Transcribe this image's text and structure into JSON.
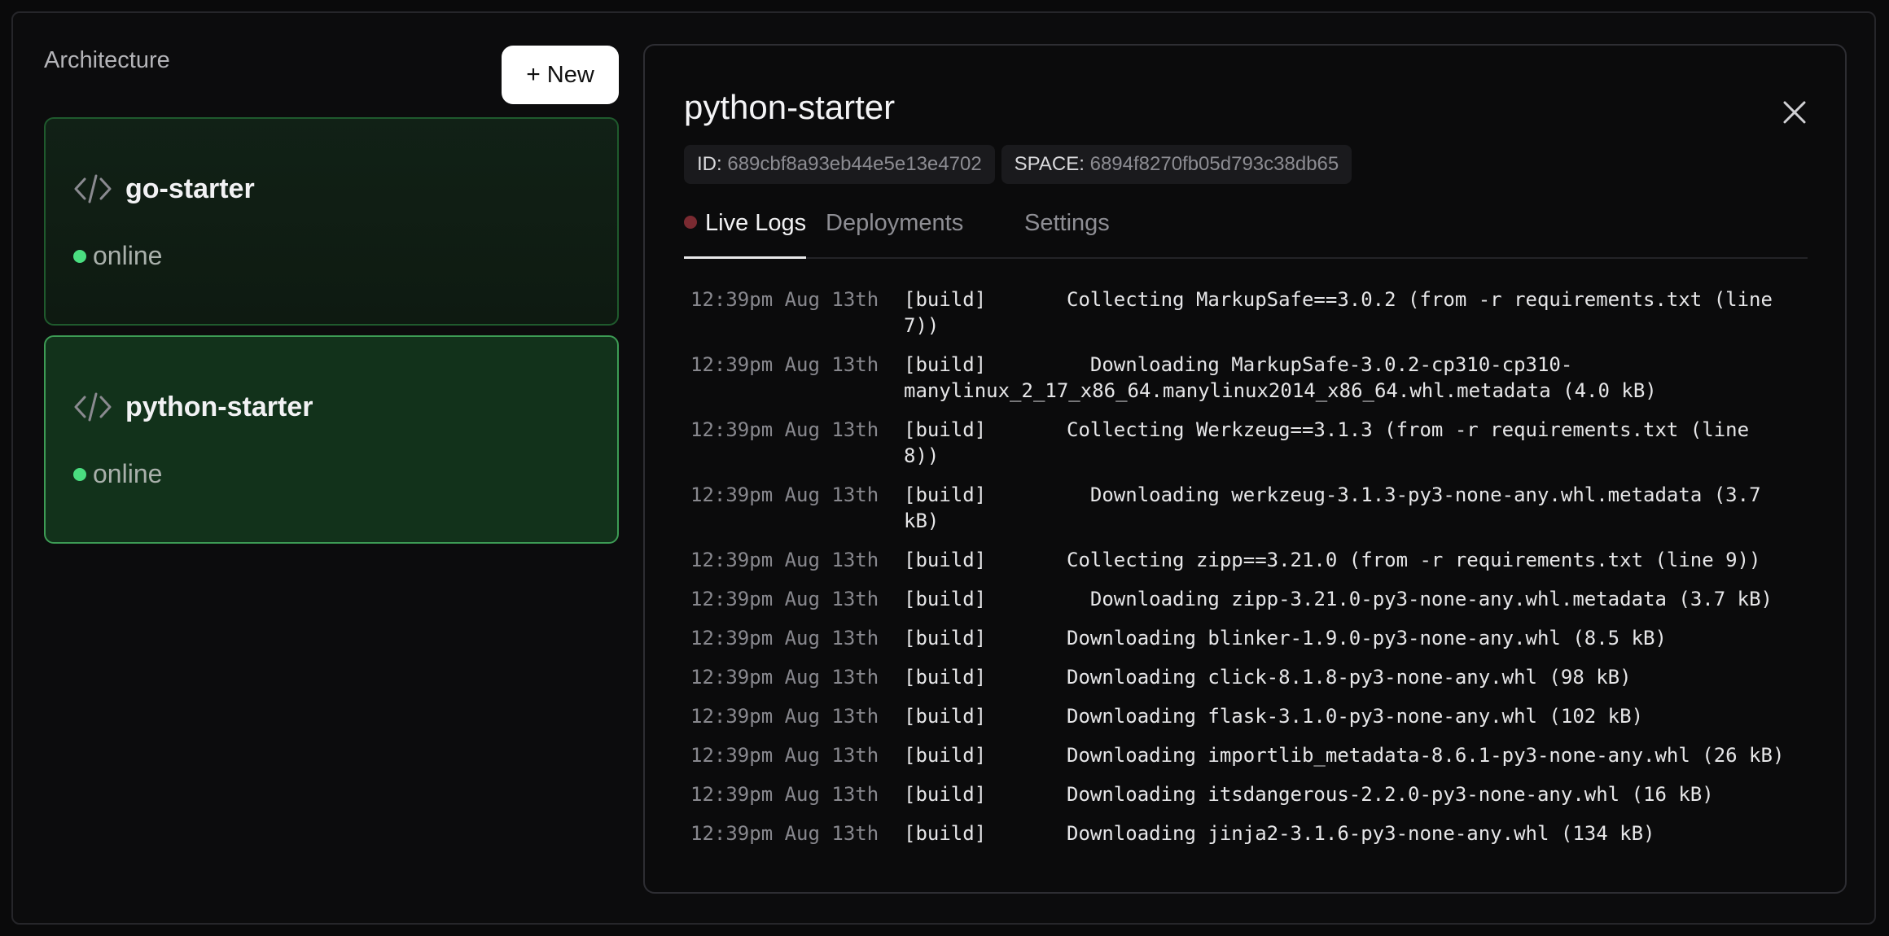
{
  "sidebar": {
    "title": "Architecture",
    "new_button": "New",
    "services": [
      {
        "name": "go-starter",
        "status": "online"
      },
      {
        "name": "python-starter",
        "status": "online"
      }
    ]
  },
  "panel": {
    "title": "python-starter",
    "id_label": "ID:",
    "id_value": "689cbf8a93eb44e5e13e4702",
    "space_label": "SPACE:",
    "space_value": "6894f8270fb05d793c38db65",
    "tabs": {
      "logs": "Live Logs",
      "deployments": "Deployments",
      "settings": "Settings"
    },
    "logs": [
      {
        "time": "12:39pm Aug 13th",
        "tag": "[build]",
        "line1": "Collecting MarkupSafe==3.0.2 (from -r requirements.txt (line",
        "line2": "7))"
      },
      {
        "time": "12:39pm Aug 13th",
        "tag": "[build]",
        "line1": "  Downloading MarkupSafe-3.0.2-cp310-cp310-",
        "line2": "manylinux_2_17_x86_64.manylinux2014_x86_64.whl.metadata (4.0 kB)"
      },
      {
        "time": "12:39pm Aug 13th",
        "tag": "[build]",
        "line1": "Collecting Werkzeug==3.1.3 (from -r requirements.txt (line",
        "line2": "8))"
      },
      {
        "time": "12:39pm Aug 13th",
        "tag": "[build]",
        "line1": "  Downloading werkzeug-3.1.3-py3-none-any.whl.metadata (3.7",
        "line2": "kB)"
      },
      {
        "time": "12:39pm Aug 13th",
        "tag": "[build]",
        "line1": "Collecting zipp==3.21.0 (from -r requirements.txt (line 9))"
      },
      {
        "time": "12:39pm Aug 13th",
        "tag": "[build]",
        "line1": "  Downloading zipp-3.21.0-py3-none-any.whl.metadata (3.7 kB)"
      },
      {
        "time": "12:39pm Aug 13th",
        "tag": "[build]",
        "line1": "Downloading blinker-1.9.0-py3-none-any.whl (8.5 kB)"
      },
      {
        "time": "12:39pm Aug 13th",
        "tag": "[build]",
        "line1": "Downloading click-8.1.8-py3-none-any.whl (98 kB)"
      },
      {
        "time": "12:39pm Aug 13th",
        "tag": "[build]",
        "line1": "Downloading flask-3.1.0-py3-none-any.whl (102 kB)"
      },
      {
        "time": "12:39pm Aug 13th",
        "tag": "[build]",
        "line1": "Downloading importlib_metadata-8.6.1-py3-none-any.whl (26 kB)"
      },
      {
        "time": "12:39pm Aug 13th",
        "tag": "[build]",
        "line1": "Downloading itsdangerous-2.2.0-py3-none-any.whl (16 kB)"
      },
      {
        "time": "12:39pm Aug 13th",
        "tag": "[build]",
        "line1": "Downloading jinja2-3.1.6-py3-none-any.whl (134 kB)"
      }
    ]
  }
}
